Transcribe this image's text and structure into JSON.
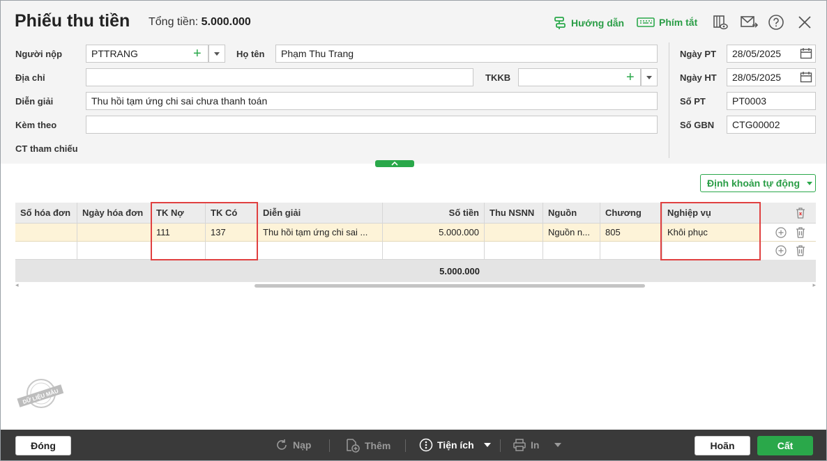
{
  "header": {
    "title": "Phiếu thu tiền",
    "total_label": "Tổng tiền:",
    "total_value": "5.000.000",
    "guide_label": "Hướng dẫn",
    "shortcut_label": "Phím tắt"
  },
  "form": {
    "payer_label": "Người nộp",
    "payer_value": "PTTRANG",
    "fullname_label": "Họ tên",
    "fullname_value": "Phạm Thu Trang",
    "address_label": "Địa chỉ",
    "address_value": "",
    "tkkb_label": "TKKB",
    "tkkb_value": "",
    "description_label": "Diễn giải",
    "description_value": "Thu hồi tạm ứng chi sai chưa thanh toán",
    "attach_label": "Kèm theo",
    "attach_value": "",
    "ref_label": "CT tham chiếu"
  },
  "side": {
    "date_pt_label": "Ngày PT",
    "date_pt_value": "28/05/2025",
    "date_ht_label": "Ngày HT",
    "date_ht_value": "28/05/2025",
    "so_pt_label": "Số PT",
    "so_pt_value": "PT0003",
    "so_gbn_label": "Số GBN",
    "so_gbn_value": "CTG00002"
  },
  "auto_button": "Định khoản tự động",
  "table": {
    "columns": [
      "Số hóa đơn",
      "Ngày hóa đơn",
      "TK Nợ",
      "TK Có",
      "Diễn giải",
      "Số tiền",
      "Thu NSNN",
      "Nguồn",
      "Chương",
      "Nghiệp vụ"
    ],
    "rows": [
      [
        "",
        "",
        "111",
        "137",
        "Thu hồi tạm ứng chi sai ...",
        "5.000.000",
        "",
        "Nguồn n...",
        "805",
        "Khôi phục"
      ],
      [
        "",
        "",
        "",
        "",
        "",
        "",
        "",
        "",
        "",
        ""
      ]
    ],
    "total": "5.000.000"
  },
  "stamp_text": "DỮ LIỆU MẪU",
  "footer": {
    "close": "Đóng",
    "reload": "Nạp",
    "add": "Thêm",
    "utilities": "Tiện ích",
    "print": "In",
    "cancel": "Hoãn",
    "save": "Cất"
  },
  "colors": {
    "accent": "#2aa84a",
    "highlight": "#e04040",
    "row_selected": "#fdf3d8"
  }
}
